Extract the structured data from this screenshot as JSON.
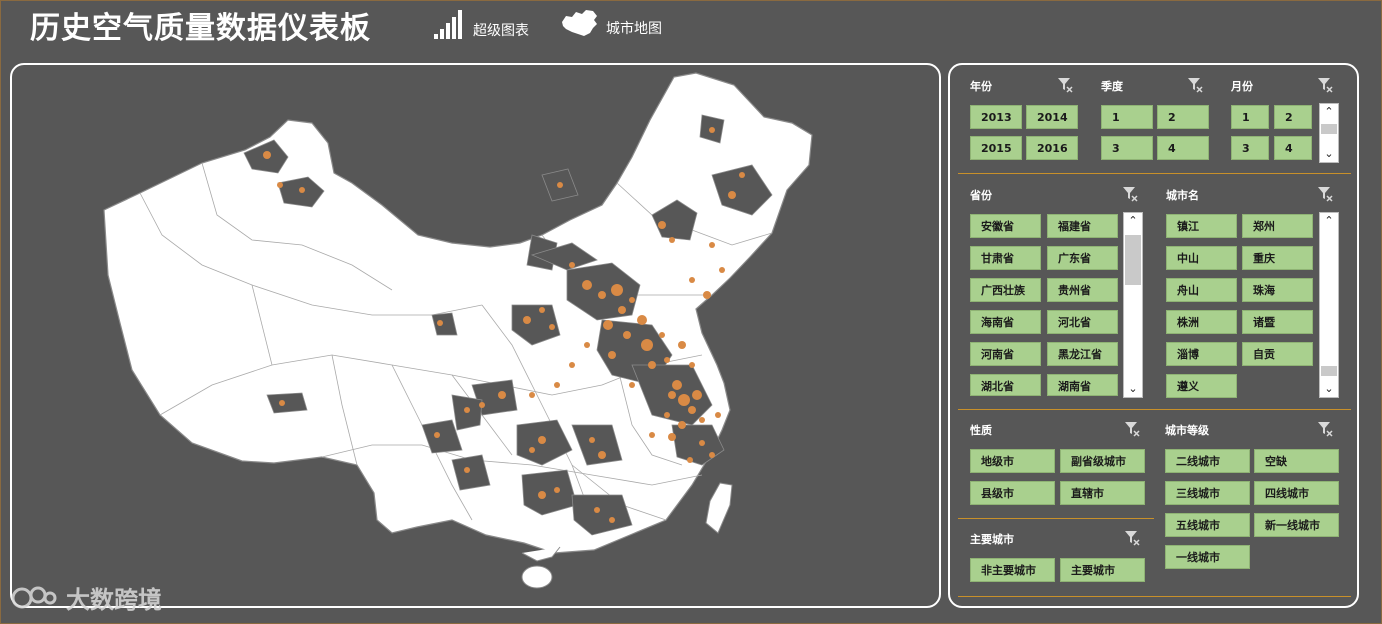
{
  "header": {
    "title": "历史空气质量数据仪表板",
    "nav": [
      {
        "label": "超级图表",
        "icon": "bar-chart-icon"
      },
      {
        "label": "城市地图",
        "icon": "china-map-icon"
      }
    ]
  },
  "filters": {
    "year": {
      "title": "年份",
      "options": [
        "2013",
        "2014",
        "2015",
        "2016"
      ]
    },
    "quarter": {
      "title": "季度",
      "options": [
        "1",
        "2",
        "3",
        "4"
      ]
    },
    "month": {
      "title": "月份",
      "options": [
        "1",
        "2",
        "3",
        "4"
      ]
    },
    "province": {
      "title": "省份",
      "options": [
        "安徽省",
        "福建省",
        "甘肃省",
        "广东省",
        "广西壮族",
        "贵州省",
        "海南省",
        "河北省",
        "河南省",
        "黑龙江省",
        "湖北省",
        "湖南省"
      ]
    },
    "city": {
      "title": "城市名",
      "options": [
        "镇江",
        "郑州",
        "中山",
        "重庆",
        "舟山",
        "珠海",
        "株洲",
        "诸暨",
        "淄博",
        "自贡",
        "遵义"
      ]
    },
    "nature": {
      "title": "性质",
      "options": [
        "地级市",
        "副省级城市",
        "县级市",
        "直辖市"
      ]
    },
    "tier": {
      "title": "城市等级",
      "options": [
        "二线城市",
        "空缺",
        "三线城市",
        "四线城市",
        "五线城市",
        "新一线城市",
        "一线城市"
      ]
    },
    "major": {
      "title": "主要城市",
      "options": [
        "非主要城市",
        "主要城市"
      ]
    }
  },
  "watermark": {
    "text": "大数跨境",
    "icon": "logo-icon"
  },
  "colors": {
    "background": "#575757",
    "button": "#a9d08e",
    "dot": "#d98a45",
    "divider": "#c8902a"
  }
}
